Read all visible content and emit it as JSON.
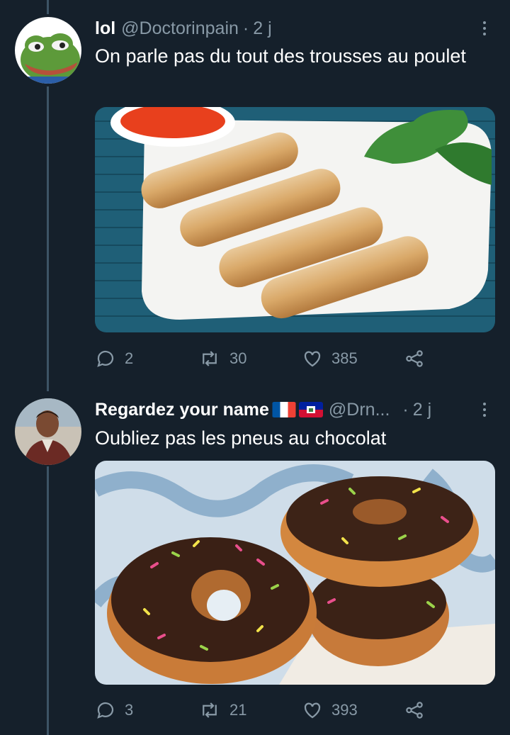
{
  "tweets": [
    {
      "name": "lol",
      "handle": "@Doctorinpain",
      "separator": "·",
      "time": "2 j",
      "text": "On parle pas du tout des trousses au poulet",
      "replies": "2",
      "retweets": "30",
      "likes": "385"
    },
    {
      "name": "Regardez your name",
      "handle": "@Drn...",
      "separator": "·",
      "time": "2 j",
      "text": "Oubliez pas les pneus au chocolat",
      "replies": "3",
      "retweets": "21",
      "likes": "393"
    }
  ],
  "icons": {
    "reply": "reply-icon",
    "retweet": "retweet-icon",
    "like": "heart-icon",
    "share": "share-icon",
    "more": "more-options-icon"
  },
  "colors": {
    "background": "#15202b",
    "secondary_text": "#8899a6",
    "thread_line": "#3d5466"
  }
}
